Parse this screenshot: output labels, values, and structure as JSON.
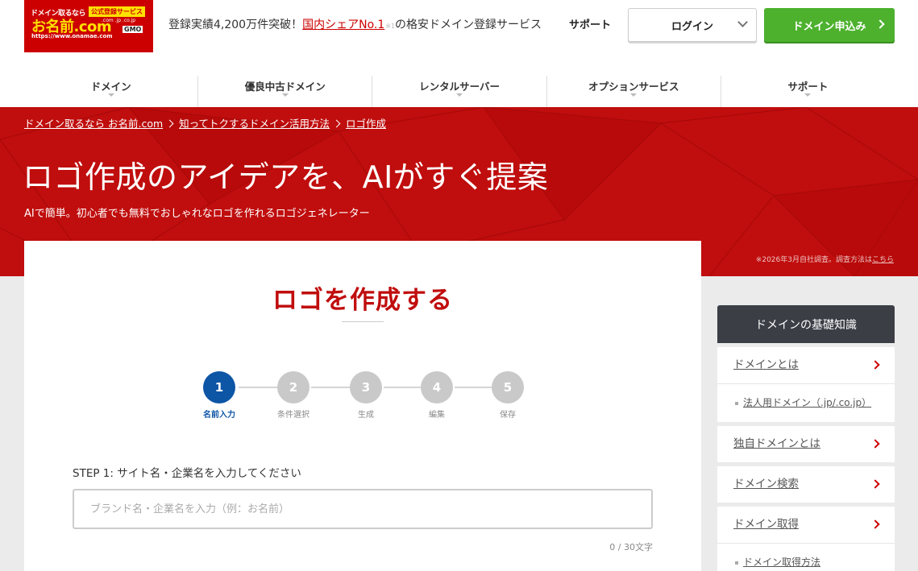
{
  "header": {
    "logo": {
      "tag_left": "ドメイン取るなら",
      "tag_badge": "公式登録サービス",
      "wordmark": "お名前.com",
      "tlds": ".com .jp .co.jp",
      "url": "https://www.onamae.com",
      "gmo": "GMO"
    },
    "tagline_pre": "登録実績4,200万件突破！",
    "tagline_link": "国内シェアNo.1",
    "tagline_note": "※1",
    "tagline_post": "の格安ドメイン登録サービス",
    "support": "サポート",
    "login": "ログイン",
    "apply": "ドメイン申込み"
  },
  "nav": [
    "ドメイン",
    "優良中古ドメイン",
    "レンタルサーバー",
    "オプションサービス",
    "サポート"
  ],
  "hero": {
    "breadcrumb": [
      "ドメイン取るなら お名前.com",
      "知ってトクするドメイン活用方法",
      "ロゴ作成"
    ],
    "title": "ロゴ作成のアイデアを、AIがすぐ提案",
    "subtitle": "AIで簡単。初心者でも無料でおしゃれなロゴを作れるロゴジェネレーター",
    "note": "※2026年3月自社調査。調査方法は",
    "note_link": "こちら",
    "color": "#c00d0d"
  },
  "card": {
    "title": "ロゴを作成する",
    "steps": [
      {
        "num": "1",
        "label": "名前入力",
        "active": true
      },
      {
        "num": "2",
        "label": "条件選択",
        "active": false
      },
      {
        "num": "3",
        "label": "生成",
        "active": false
      },
      {
        "num": "4",
        "label": "編集",
        "active": false
      },
      {
        "num": "5",
        "label": "保存",
        "active": false
      }
    ],
    "step_label": "STEP 1: サイト名・企業名を入力してください",
    "input_placeholder": "ブランド名・企業名を入力（例：お名前）",
    "input_value": "",
    "char_count": "0 / 30文字"
  },
  "sidebar": {
    "heading": "ドメインの基礎知識",
    "groups": [
      {
        "label": "ドメインとは",
        "sub": [
          "法人用ドメイン（.jp/.co.jp）"
        ]
      },
      {
        "label": "独自ドメインとは",
        "sub": []
      },
      {
        "label": "ドメイン検索",
        "sub": []
      },
      {
        "label": "ドメイン取得",
        "sub": [
          "ドメイン取得方法"
        ]
      }
    ]
  },
  "colors": {
    "brand_red": "#cc0000",
    "apply_green": "#4db12e",
    "step_active": "#0d55a5",
    "sidebar_head": "#3b3e45"
  }
}
